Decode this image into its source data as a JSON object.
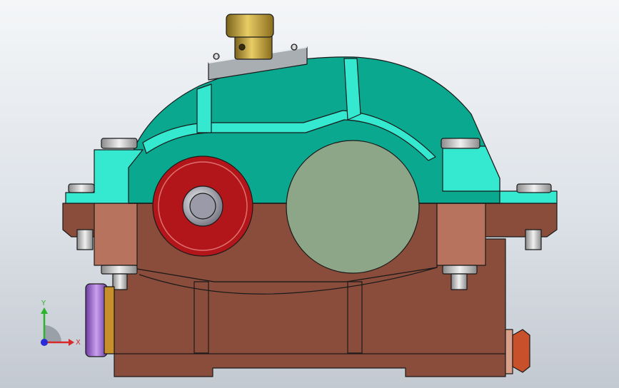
{
  "viewport": {
    "background_top": "#f4f6f8",
    "background_bottom": "#c3c9d1"
  },
  "model": {
    "cover_color": "#0aa88f",
    "cover_highlight": "#35e8d0",
    "base_color": "#8b4d3b",
    "base_highlight": "#b7735d",
    "seal_ring_color": "#b3161a",
    "bearing_cap_color": "#8da688",
    "bolt_color": "#c4c4c4",
    "vent_plug_color": "#b89a2a",
    "oil_gauge_color": "#9a64c6",
    "drain_plug_color": "#c8502a",
    "outline_color": "#1a1a1a"
  },
  "triad": {
    "x_label": "X",
    "y_label": "Y",
    "x_color": "#d62a2a",
    "y_color": "#2ab52a",
    "z_color": "#2a2ad6"
  }
}
